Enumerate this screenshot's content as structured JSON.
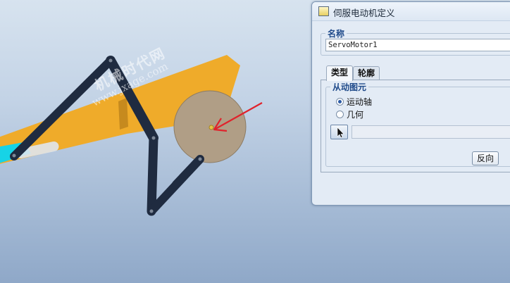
{
  "viewport": {
    "watermark_cn": "机械时代网",
    "watermark_url": "www.jxage.com",
    "colors": {
      "link_plate": "#efab2a",
      "link_bar": "#1f2b40",
      "crank_disk": "#b09e86",
      "pointer_arrow": "#e0232c",
      "slot_highlight": "#17d3e6"
    }
  },
  "dialog": {
    "title": "伺服电动机定义",
    "name_group": {
      "legend": "名称",
      "value": "ServoMotor1"
    },
    "tabs": [
      {
        "label": "类型",
        "active": true
      },
      {
        "label": "轮廓",
        "active": false
      }
    ],
    "driven_group": {
      "legend": "从动图元",
      "options": [
        {
          "label": "运动轴",
          "checked": true
        },
        {
          "label": "几何",
          "checked": false
        }
      ],
      "select_icon": "cursor-arrow-icon",
      "selection_value": ""
    },
    "flip_button_label": "反向"
  }
}
